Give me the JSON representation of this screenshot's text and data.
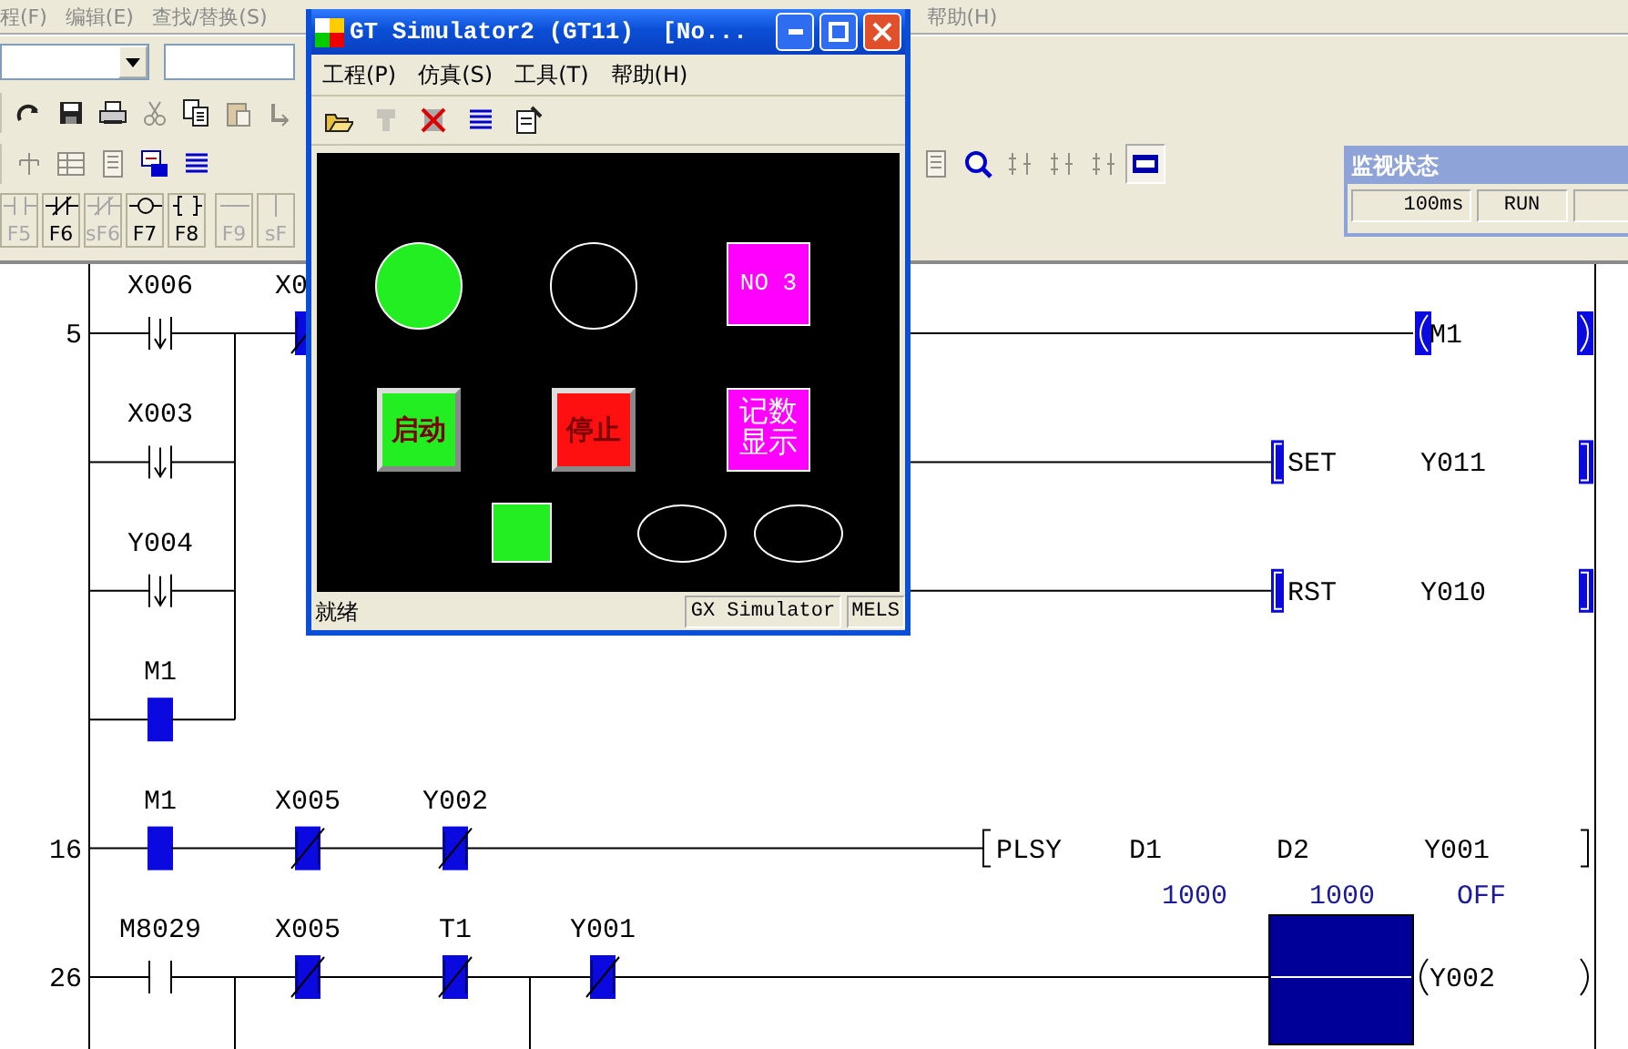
{
  "menu": [
    {
      "label": "程(F)"
    },
    {
      "label": "编辑(E)"
    },
    {
      "label": "查找/替换(S)"
    },
    {
      "label": "帮助(H)"
    }
  ],
  "toolbars": [
    {
      "buttons": [
        {
          "kind": "redo",
          "disabled": false
        },
        {
          "kind": "save",
          "disabled": false
        },
        {
          "kind": "print",
          "disabled": false
        },
        {
          "kind": "cut",
          "disabled": true
        },
        {
          "kind": "copy",
          "disabled": false
        },
        {
          "kind": "paste",
          "disabled": true
        },
        {
          "kind": "undo",
          "disabled": true
        }
      ]
    },
    {
      "buttons": [
        {
          "kind": "tree",
          "disabled": true
        },
        {
          "kind": "grid",
          "disabled": true
        },
        {
          "kind": "sheet",
          "disabled": true
        },
        {
          "kind": "ladder",
          "disabled": false
        },
        {
          "kind": "list",
          "disabled": false
        }
      ]
    },
    {
      "buttons": [
        {
          "kind": "sheet",
          "disabled": true
        },
        {
          "kind": "find",
          "disabled": false
        },
        {
          "kind": "step",
          "disabled": true
        },
        {
          "kind": "step",
          "disabled": true
        },
        {
          "kind": "step",
          "disabled": true
        },
        {
          "kind": "monitor",
          "disabled": false,
          "pressed": true
        }
      ]
    }
  ],
  "function_keys": [
    {
      "kind": "no",
      "key": "F5",
      "disabled": true
    },
    {
      "kind": "nc",
      "key": "F6",
      "disabled": false
    },
    {
      "kind": "nc",
      "key": "sF6",
      "disabled": true
    },
    {
      "kind": "coil",
      "key": "F7",
      "disabled": false
    },
    {
      "kind": "instr",
      "key": "F8",
      "disabled": false
    },
    {
      "kind": "hline",
      "key": "F9",
      "disabled": true
    },
    {
      "kind": "vline",
      "key": "sF",
      "disabled": true
    }
  ],
  "monitor_status": {
    "title": "监视状态",
    "fields": [
      "100ms",
      "RUN"
    ]
  },
  "ladder": {
    "rungs": [
      {
        "step": "5",
        "rows": [
          {
            "contacts": [
              {
                "label": "X006",
                "kind": "falling",
                "on": false
              },
              {
                "label": "X0",
                "kind": "nc",
                "on": true,
                "cut_off": true
              }
            ],
            "output": {
              "kind": "coil",
              "on": true,
              "operands": [
                {
                  "label": "M1"
                }
              ]
            }
          },
          {
            "contacts": [
              {
                "label": "X003",
                "kind": "falling",
                "on": false
              }
            ],
            "output": {
              "kind": "instruction",
              "name": "SET",
              "on": true,
              "operands": [
                {
                  "label": "Y011"
                }
              ]
            }
          },
          {
            "contacts": [
              {
                "label": "Y004",
                "kind": "falling",
                "on": false
              }
            ],
            "output": {
              "kind": "instruction",
              "name": "RST",
              "on": true,
              "operands": [
                {
                  "label": "Y010"
                }
              ]
            }
          },
          {
            "contacts": [
              {
                "label": "M1",
                "kind": "no",
                "on": true
              }
            ]
          }
        ]
      },
      {
        "step": "16",
        "rows": [
          {
            "contacts": [
              {
                "label": "M1",
                "kind": "no",
                "on": true
              },
              {
                "label": "X005",
                "kind": "nc",
                "on": true
              },
              {
                "label": "Y002",
                "kind": "nc",
                "on": true
              }
            ],
            "output": {
              "kind": "instruction",
              "name": "PLSY",
              "on": false,
              "operands": [
                {
                  "label": "D1",
                  "value": "1000"
                },
                {
                  "label": "D2",
                  "value": "1000"
                },
                {
                  "label": "Y001",
                  "value": "OFF"
                }
              ]
            }
          }
        ]
      },
      {
        "step": "26",
        "cursor": true,
        "rows": [
          {
            "contacts": [
              {
                "label": "M8029",
                "kind": "no",
                "on": false,
                "branch_below": true
              },
              {
                "label": "X005",
                "kind": "nc",
                "on": true
              },
              {
                "label": "T1",
                "kind": "nc",
                "on": true,
                "branch_below": true
              },
              {
                "label": "Y001",
                "kind": "nc",
                "on": true
              }
            ],
            "output": {
              "kind": "coil",
              "on": false,
              "operands": [
                {
                  "label": "Y002"
                }
              ]
            }
          }
        ]
      }
    ]
  },
  "simulator": {
    "title": "GT Simulator2 (GT11)  [No...",
    "menu": [
      {
        "label": "工程(P)"
      },
      {
        "label": "仿真(S)"
      },
      {
        "label": "工具(T)"
      },
      {
        "label": "帮助(H)"
      }
    ],
    "toolbar": [
      {
        "kind": "open",
        "disabled": false
      },
      {
        "kind": "tool",
        "disabled": true
      },
      {
        "kind": "stop",
        "disabled": false
      },
      {
        "kind": "list",
        "disabled": false
      },
      {
        "kind": "props",
        "disabled": false
      }
    ],
    "screen": [
      {
        "kind": "lamp",
        "on": true
      },
      {
        "kind": "lamp",
        "on": false
      },
      {
        "kind": "display",
        "text": "NO 3",
        "color": "#ff00ff"
      },
      {
        "kind": "button",
        "text": "启动",
        "color": "#22ee22"
      },
      {
        "kind": "button",
        "text": "停止",
        "color": "#ff1010"
      },
      {
        "kind": "display",
        "text": "记数显示",
        "color": "#ff00ff"
      },
      {
        "kind": "indicator",
        "color": "#22ee22"
      },
      {
        "kind": "oval",
        "on": false
      },
      {
        "kind": "oval",
        "on": false
      }
    ],
    "status": [
      "就绪",
      "GX Simulator",
      "MELS"
    ]
  }
}
